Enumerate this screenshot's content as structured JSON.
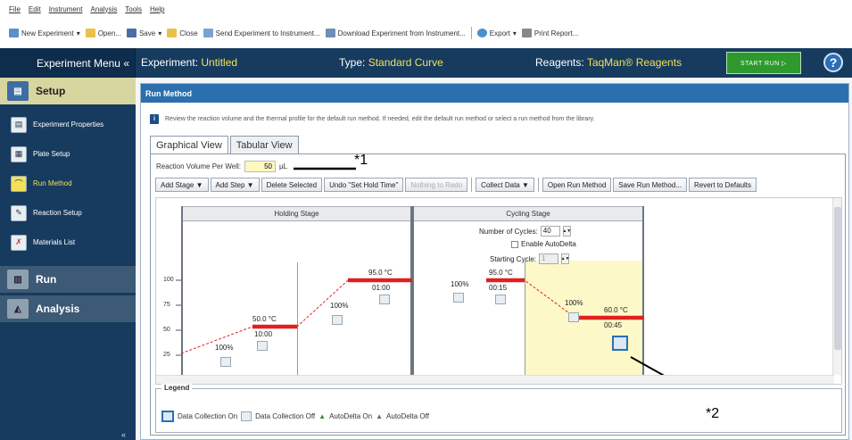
{
  "menubar": [
    "File",
    "Edit",
    "Instrument",
    "Analysis",
    "Tools",
    "Help"
  ],
  "toolbar": {
    "new_experiment": "New Experiment",
    "open": "Open...",
    "save": "Save",
    "close": "Close",
    "send": "Send Experiment to Instrument...",
    "download": "Download Experiment from Instrument...",
    "export": "Export",
    "print": "Print Report..."
  },
  "header": {
    "experiment_menu": "Experiment Menu «",
    "experiment_label": "Experiment:",
    "experiment_value": "Untitled",
    "type_label": "Type:",
    "type_value": "Standard Curve",
    "reagents_label": "Reagents:",
    "reagents_value": "TaqMan® Reagents",
    "start_run": "START RUN ▷",
    "help": "?"
  },
  "sidebar": {
    "setup": "Setup",
    "items": [
      {
        "label": "Experiment Properties",
        "icon": "document-icon"
      },
      {
        "label": "Plate Setup",
        "icon": "plate-icon"
      },
      {
        "label": "Run Method",
        "icon": "run-method-icon"
      },
      {
        "label": "Reaction Setup",
        "icon": "pipette-icon"
      },
      {
        "label": "Materials List",
        "icon": "materials-icon"
      }
    ],
    "run": "Run",
    "analysis": "Analysis",
    "collapse": "«"
  },
  "panel": {
    "title": "Run Method",
    "info": "Review the reaction volume and the thermal profile for the default run method. If needed, edit the default run method or select a run method from the library.",
    "tabs": [
      "Graphical View",
      "Tabular View"
    ],
    "reaction_volume_label": "Reaction Volume Per Well:",
    "reaction_volume_value": "50",
    "reaction_volume_unit": "µL",
    "callout1": "*1",
    "callout2": "*2",
    "buttons": {
      "add_stage": "Add Stage ▼",
      "add_step": "Add Step ▼",
      "delete": "Delete Selected",
      "undo": "Undo \"Set Hold Time\"",
      "redo": "Nothing to Redo",
      "collect": "Collect Data ▼",
      "open_method": "Open Run Method",
      "save_method": "Save Run Method...",
      "revert": "Revert to Defaults"
    }
  },
  "plot": {
    "y_ticks": [
      "100",
      "75",
      "50",
      "25"
    ],
    "holding_stage": "Holding Stage",
    "cycling_stage": "Cycling Stage",
    "cycles_label": "Number of Cycles:",
    "cycles_value": "40",
    "autodelta_label": "Enable AutoDelta",
    "starting_cycle_label": "Starting Cycle:",
    "starting_cycle_value": "1",
    "steps": [
      {
        "ramp": "100%",
        "temp": "50.0 °C",
        "time": "10:00"
      },
      {
        "ramp": "100%",
        "temp": "95.0 °C",
        "time": "01:00"
      },
      {
        "ramp": "100%",
        "temp": "95.0 °C",
        "time": "00:15"
      },
      {
        "ramp": "100%",
        "temp": "60.0 °C",
        "time": "00:45"
      }
    ]
  },
  "legend": {
    "title": "Legend",
    "data_on": "Data Collection On",
    "data_off": "Data Collection Off",
    "autodelta_on": "AutoDelta On",
    "autodelta_off": "AutoDelta Off"
  },
  "colors": {
    "header_bg": "#163b5e",
    "accent_yellow": "#f2e05a",
    "start_green": "#2e9a2e",
    "panel_blue": "#2c6fae",
    "step_red": "#e02020",
    "selected_step_bg": "#fdf8c8"
  }
}
